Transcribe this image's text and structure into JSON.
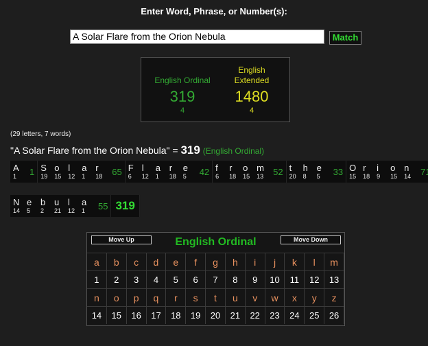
{
  "header": {
    "title": "Enter Word, Phrase, or Number(s):"
  },
  "search": {
    "value": "A Solar Flare from the Orion Nebula",
    "button_label": "Match"
  },
  "summary": {
    "english_ordinal": {
      "label": "English Ordinal",
      "value": "319",
      "sub": "4"
    },
    "english_extended": {
      "label_line1": "English",
      "label_line2": "Extended",
      "value": "1480",
      "sub": "4"
    }
  },
  "breakdown": {
    "count_text": "(29 letters, 7 words)",
    "phrase_quoted": "\"A Solar Flare from the Orion Nebula\"",
    "equals": "=",
    "total": "319",
    "cipher_label": "(English Ordinal)",
    "row1": [
      {
        "letters": [
          [
            "A",
            "1"
          ]
        ],
        "total": "1"
      },
      {
        "letters": [
          [
            "S",
            "19"
          ],
          [
            "o",
            "15"
          ],
          [
            "l",
            "12"
          ],
          [
            "a",
            "1"
          ],
          [
            "r",
            "18"
          ]
        ],
        "total": "65"
      },
      {
        "letters": [
          [
            "F",
            "6"
          ],
          [
            "l",
            "12"
          ],
          [
            "a",
            "1"
          ],
          [
            "r",
            "18"
          ],
          [
            "e",
            "5"
          ]
        ],
        "total": "42"
      },
      {
        "letters": [
          [
            "f",
            "6"
          ],
          [
            "r",
            "18"
          ],
          [
            "o",
            "15"
          ],
          [
            "m",
            "13"
          ]
        ],
        "total": "52"
      },
      {
        "letters": [
          [
            "t",
            "20"
          ],
          [
            "h",
            "8"
          ],
          [
            "e",
            "5"
          ]
        ],
        "total": "33"
      },
      {
        "letters": [
          [
            "O",
            "15"
          ],
          [
            "r",
            "18"
          ],
          [
            "i",
            "9"
          ],
          [
            "o",
            "15"
          ],
          [
            "n",
            "14"
          ]
        ],
        "total": "71"
      }
    ],
    "row2": [
      {
        "letters": [
          [
            "N",
            "14"
          ],
          [
            "e",
            "5"
          ],
          [
            "b",
            "2"
          ],
          [
            "u",
            "21"
          ],
          [
            "l",
            "12"
          ],
          [
            "a",
            "1"
          ]
        ],
        "total": "55"
      }
    ],
    "grand_total": "319"
  },
  "chart": {
    "move_up_label": "Move Up",
    "move_down_label": "Move Down",
    "title": "English Ordinal",
    "rows": [
      [
        "a",
        "b",
        "c",
        "d",
        "e",
        "f",
        "g",
        "h",
        "i",
        "j",
        "k",
        "l",
        "m"
      ],
      [
        "1",
        "2",
        "3",
        "4",
        "5",
        "6",
        "7",
        "8",
        "9",
        "10",
        "11",
        "12",
        "13"
      ],
      [
        "n",
        "o",
        "p",
        "q",
        "r",
        "s",
        "t",
        "u",
        "v",
        "w",
        "x",
        "y",
        "z"
      ],
      [
        "14",
        "15",
        "16",
        "17",
        "18",
        "19",
        "20",
        "21",
        "22",
        "23",
        "24",
        "25",
        "26"
      ]
    ]
  },
  "colors": {
    "background": "#1e1e1e",
    "green": "#33aa33",
    "yellow": "#dddd22",
    "letter_orange": "#e8915f"
  }
}
